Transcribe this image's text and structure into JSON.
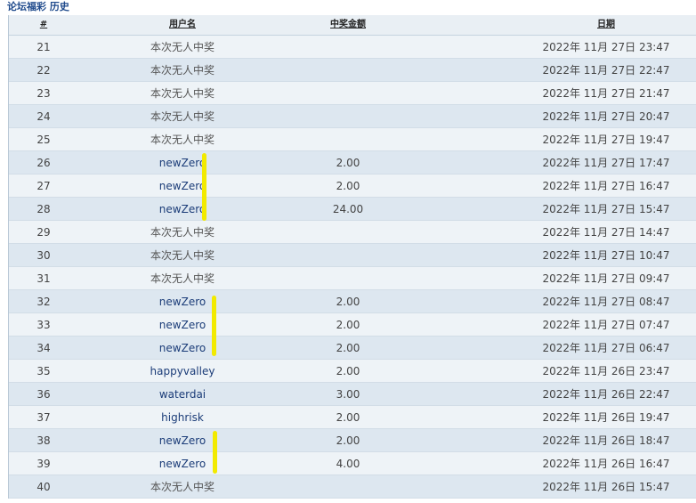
{
  "page": {
    "title": "论坛福彩 历史"
  },
  "table": {
    "headers": {
      "num": "#",
      "user": "用户名",
      "amount": "中奖金额",
      "date": "日期"
    },
    "rows": [
      {
        "num": "21",
        "user": "本次无人中奖",
        "amount": "",
        "date": "2022年 11月 27日 23:47"
      },
      {
        "num": "22",
        "user": "本次无人中奖",
        "amount": "",
        "date": "2022年 11月 27日 22:47"
      },
      {
        "num": "23",
        "user": "本次无人中奖",
        "amount": "",
        "date": "2022年 11月 27日 21:47"
      },
      {
        "num": "24",
        "user": "本次无人中奖",
        "amount": "",
        "date": "2022年 11月 27日 20:47"
      },
      {
        "num": "25",
        "user": "本次无人中奖",
        "amount": "",
        "date": "2022年 11月 27日 19:47"
      },
      {
        "num": "26",
        "user": "newZero",
        "amount": "2.00",
        "date": "2022年 11月 27日 17:47"
      },
      {
        "num": "27",
        "user": "newZero",
        "amount": "2.00",
        "date": "2022年 11月 27日 16:47"
      },
      {
        "num": "28",
        "user": "newZero",
        "amount": "24.00",
        "date": "2022年 11月 27日 15:47"
      },
      {
        "num": "29",
        "user": "本次无人中奖",
        "amount": "",
        "date": "2022年 11月 27日 14:47"
      },
      {
        "num": "30",
        "user": "本次无人中奖",
        "amount": "",
        "date": "2022年 11月 27日 10:47"
      },
      {
        "num": "31",
        "user": "本次无人中奖",
        "amount": "",
        "date": "2022年 11月 27日 09:47"
      },
      {
        "num": "32",
        "user": "newZero",
        "amount": "2.00",
        "date": "2022年 11月 27日 08:47"
      },
      {
        "num": "33",
        "user": "newZero",
        "amount": "2.00",
        "date": "2022年 11月 27日 07:47"
      },
      {
        "num": "34",
        "user": "newZero",
        "amount": "2.00",
        "date": "2022年 11月 27日 06:47"
      },
      {
        "num": "35",
        "user": "happyvalley",
        "amount": "2.00",
        "date": "2022年 11月 26日 23:47"
      },
      {
        "num": "36",
        "user": "waterdai",
        "amount": "3.00",
        "date": "2022年 11月 26日 22:47"
      },
      {
        "num": "37",
        "user": "highrisk",
        "amount": "2.00",
        "date": "2022年 11月 26日 19:47"
      },
      {
        "num": "38",
        "user": "newZero",
        "amount": "2.00",
        "date": "2022年 11月 26日 18:47"
      },
      {
        "num": "39",
        "user": "newZero",
        "amount": "4.00",
        "date": "2022年 11月 26日 16:47"
      },
      {
        "num": "40",
        "user": "本次无人中奖",
        "amount": "",
        "date": "2022年 11月 26日 15:47"
      }
    ]
  },
  "colors": {
    "marker": "#f2ea00",
    "link": "#1b3c78",
    "row_odd": "#eef3f7",
    "row_even": "#dde7f0"
  }
}
